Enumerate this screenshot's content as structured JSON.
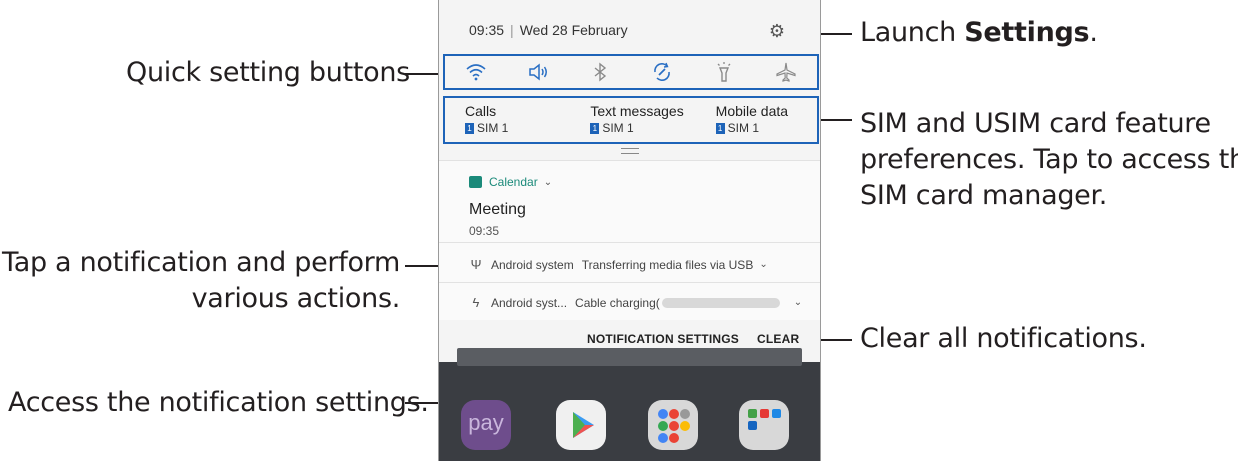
{
  "phone": {
    "time": "09:35",
    "date": "Wed 28 February",
    "quick_settings": [
      "wifi-icon",
      "sound-icon",
      "bluetooth-icon",
      "auto-rotate-icon",
      "flashlight-icon",
      "airplane-mode-icon"
    ],
    "sim": [
      {
        "title": "Calls",
        "badge": "1",
        "value": "SIM 1"
      },
      {
        "title": "Text messages",
        "badge": "1",
        "value": "SIM 1"
      },
      {
        "title": "Mobile data",
        "badge": "1",
        "value": "SIM 1"
      }
    ],
    "calendar": {
      "app": "Calendar",
      "title": "Meeting",
      "time": "09:35"
    },
    "usb_notification": {
      "app": "Android system",
      "text": "Transferring media files via USB"
    },
    "charge_notification": {
      "app": "Android syst...",
      "text": "Cable charging("
    },
    "notification_settings_label": "NOTIFICATION SETTINGS",
    "clear_label": "CLEAR",
    "apps": [
      "pay",
      "Play Store",
      "Google folder",
      "Folder"
    ],
    "pay_label": "pay"
  },
  "callouts": {
    "settings_prefix": "Launch ",
    "settings_bold": "Settings",
    "settings_suffix": ".",
    "quick": "Quick setting buttons",
    "sim_1": "SIM and USIM card feature",
    "sim_2": "preferences. Tap to access the",
    "sim_3": "SIM card manager.",
    "tap_1": "Tap a notification and perform",
    "tap_2": "various actions.",
    "clear": "Clear all notifications.",
    "access": "Access the notification settings."
  },
  "colors": {
    "accent": "#1d63b8",
    "calendar": "#1b8a7a",
    "text": "#231f20"
  }
}
